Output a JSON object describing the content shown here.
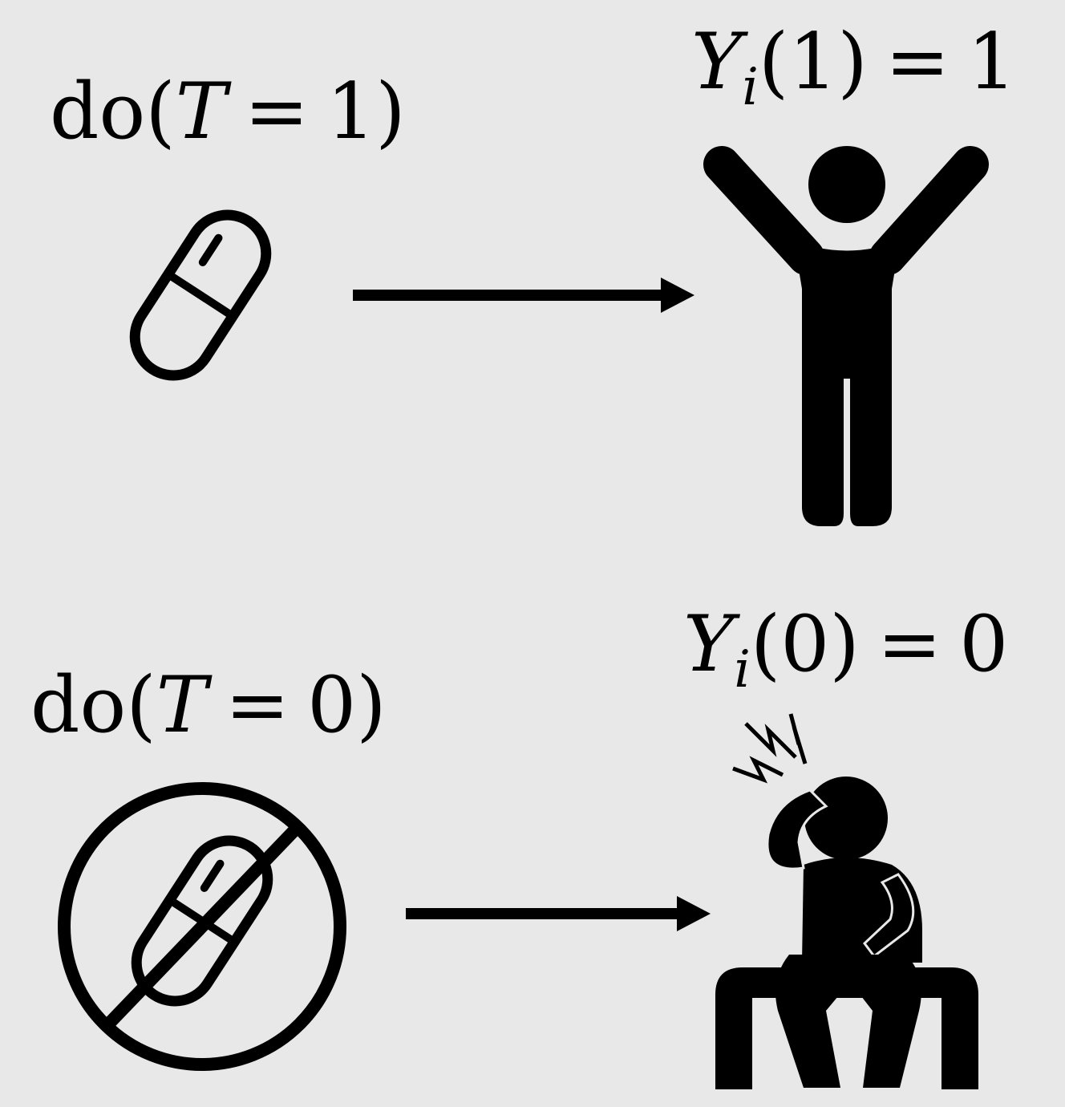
{
  "top_row": {
    "intervention": {
      "func": "do",
      "open": "(",
      "var": "T",
      "eq": "=",
      "val": "1",
      "close": ")"
    },
    "outcome": {
      "var": "Y",
      "sub": "i",
      "open": "(",
      "arg": "1",
      "close": ")",
      "eq": "=",
      "val": "1"
    },
    "treatment_icon": "pill-icon",
    "outcome_icon": "person-arms-raised-icon"
  },
  "bottom_row": {
    "intervention": {
      "func": "do",
      "open": "(",
      "var": "T",
      "eq": "=",
      "val": "0",
      "close": ")"
    },
    "outcome": {
      "var": "Y",
      "sub": "i",
      "open": "(",
      "arg": "0",
      "close": ")",
      "eq": "=",
      "val": "0"
    },
    "treatment_icon": "no-pill-icon",
    "outcome_icon": "person-headache-icon"
  },
  "colors": {
    "background": "#e8e8e8",
    "ink": "#000000"
  }
}
